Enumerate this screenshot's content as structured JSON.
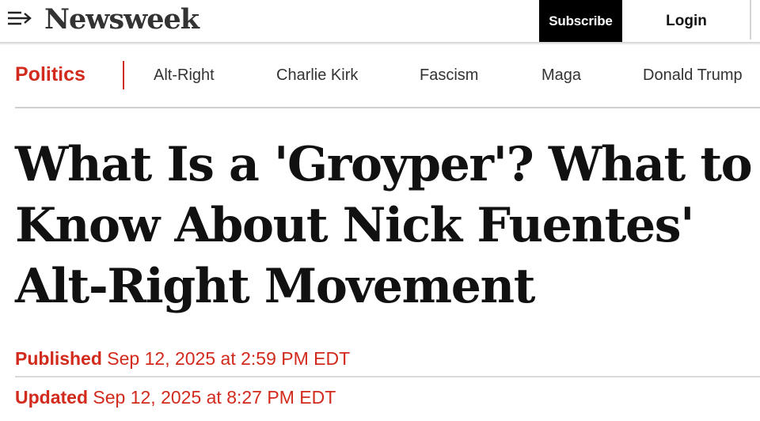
{
  "header": {
    "logo_text": "Newsweek",
    "menu_icon": "menu-arrow-icon",
    "subscribe_label": "Subscribe",
    "login_label": "Login"
  },
  "tagnav": {
    "section": "Politics",
    "tags": [
      "Alt-Right",
      "Charlie Kirk",
      "Fascism",
      "Maga",
      "Donald Trump"
    ]
  },
  "article": {
    "headline_lines": [
      "What Is a 'Groyper'? What to",
      "Know About Nick Fuentes'",
      "Alt-Right Movement"
    ],
    "published_label": "Published",
    "published_date": "Sep 12, 2025 at 2:59 PM EDT",
    "updated_label": "Updated",
    "updated_date": "Sep 12, 2025 at 8:27 PM EDT"
  },
  "colors": {
    "accent": "#d22a1c",
    "text": "#111111",
    "subscribe_bg": "#000000"
  }
}
